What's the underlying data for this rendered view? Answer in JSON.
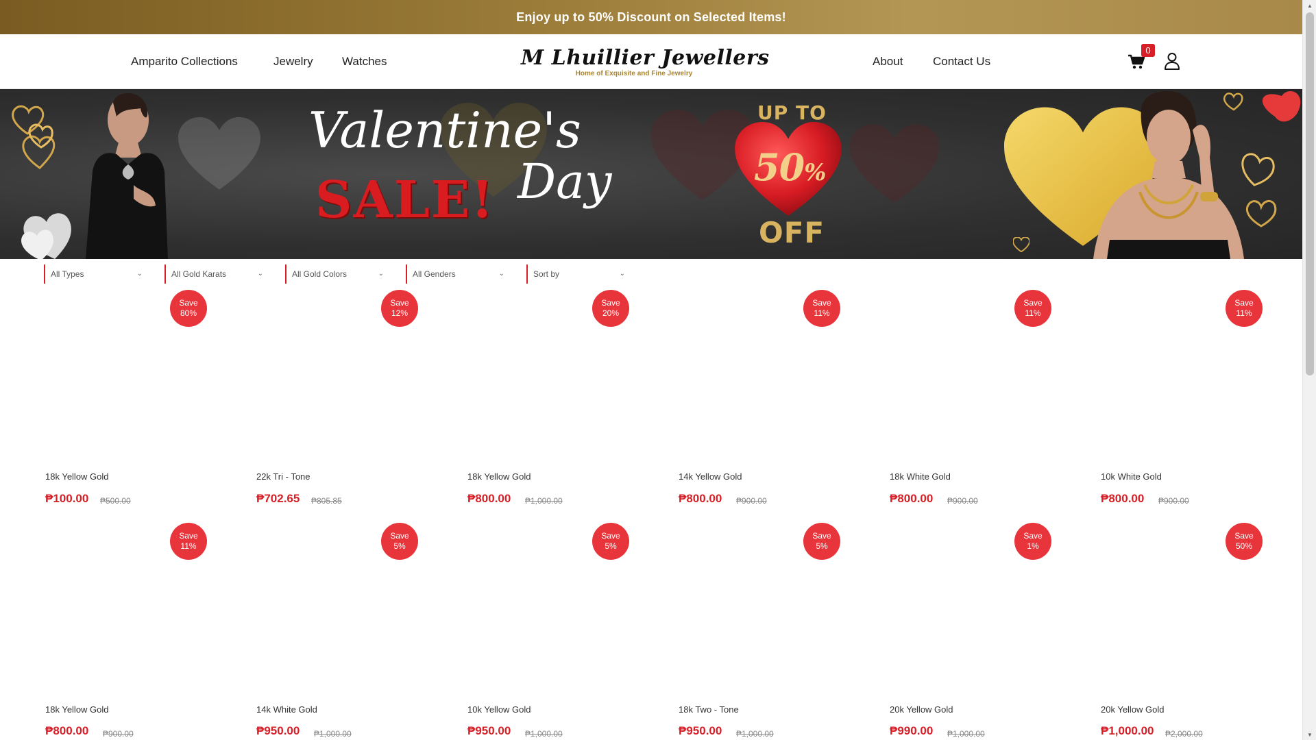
{
  "promo": {
    "text": "Enjoy up to 50% Discount on Selected Items!"
  },
  "nav": {
    "left": [
      "Amparito Collections",
      "Jewelry",
      "Watches"
    ],
    "right": [
      "About",
      "Contact Us"
    ]
  },
  "logo": {
    "name": "M Lhuillier Jewellers",
    "tagline": "Home of Exquisite and Fine Jewelry"
  },
  "cart": {
    "count": "0"
  },
  "banner": {
    "title": "Valentine's",
    "day": "Day",
    "sale": "SALE!",
    "upto": "UP TO",
    "percent": "50",
    "percent_sign": "%",
    "off": "OFF"
  },
  "filters": [
    "All Types",
    "All Gold Karats",
    "All Gold Colors",
    "All Genders",
    "Sort by"
  ],
  "products": [
    {
      "save": "Save",
      "save_pct": "80%",
      "name": "18k Yellow Gold",
      "price": "₱100.00",
      "old_price": "₱500.00"
    },
    {
      "save": "Save",
      "save_pct": "12%",
      "name": "22k Tri - Tone",
      "price": "₱702.65",
      "old_price": "₱805.85"
    },
    {
      "save": "Save",
      "save_pct": "20%",
      "name": "18k Yellow Gold",
      "price": "₱800.00",
      "old_price": "₱1,000.00"
    },
    {
      "save": "Save",
      "save_pct": "11%",
      "name": "14k Yellow Gold",
      "price": "₱800.00",
      "old_price": "₱900.00"
    },
    {
      "save": "Save",
      "save_pct": "11%",
      "name": "18k White Gold",
      "price": "₱800.00",
      "old_price": "₱900.00"
    },
    {
      "save": "Save",
      "save_pct": "11%",
      "name": "10k White Gold",
      "price": "₱800.00",
      "old_price": "₱900.00"
    },
    {
      "save": "Save",
      "save_pct": "11%",
      "name": "18k Yellow Gold",
      "price": "₱800.00",
      "old_price": "₱900.00"
    },
    {
      "save": "Save",
      "save_pct": "5%",
      "name": "14k White Gold",
      "price": "₱950.00",
      "old_price": "₱1,000.00"
    },
    {
      "save": "Save",
      "save_pct": "5%",
      "name": "10k Yellow Gold",
      "price": "₱950.00",
      "old_price": "₱1,000.00"
    },
    {
      "save": "Save",
      "save_pct": "5%",
      "name": "18k Two - Tone",
      "price": "₱950.00",
      "old_price": "₱1,000.00"
    },
    {
      "save": "Save",
      "save_pct": "1%",
      "name": "20k Yellow Gold",
      "price": "₱990.00",
      "old_price": "₱1,000.00"
    },
    {
      "save": "Save",
      "save_pct": "50%",
      "name": "20k Yellow Gold",
      "price": "₱1,000.00",
      "old_price": "₱2,000.00"
    }
  ],
  "colors": {
    "accent_red": "#d61f26",
    "badge_red": "#e8353b",
    "gold": "#a8842e"
  }
}
